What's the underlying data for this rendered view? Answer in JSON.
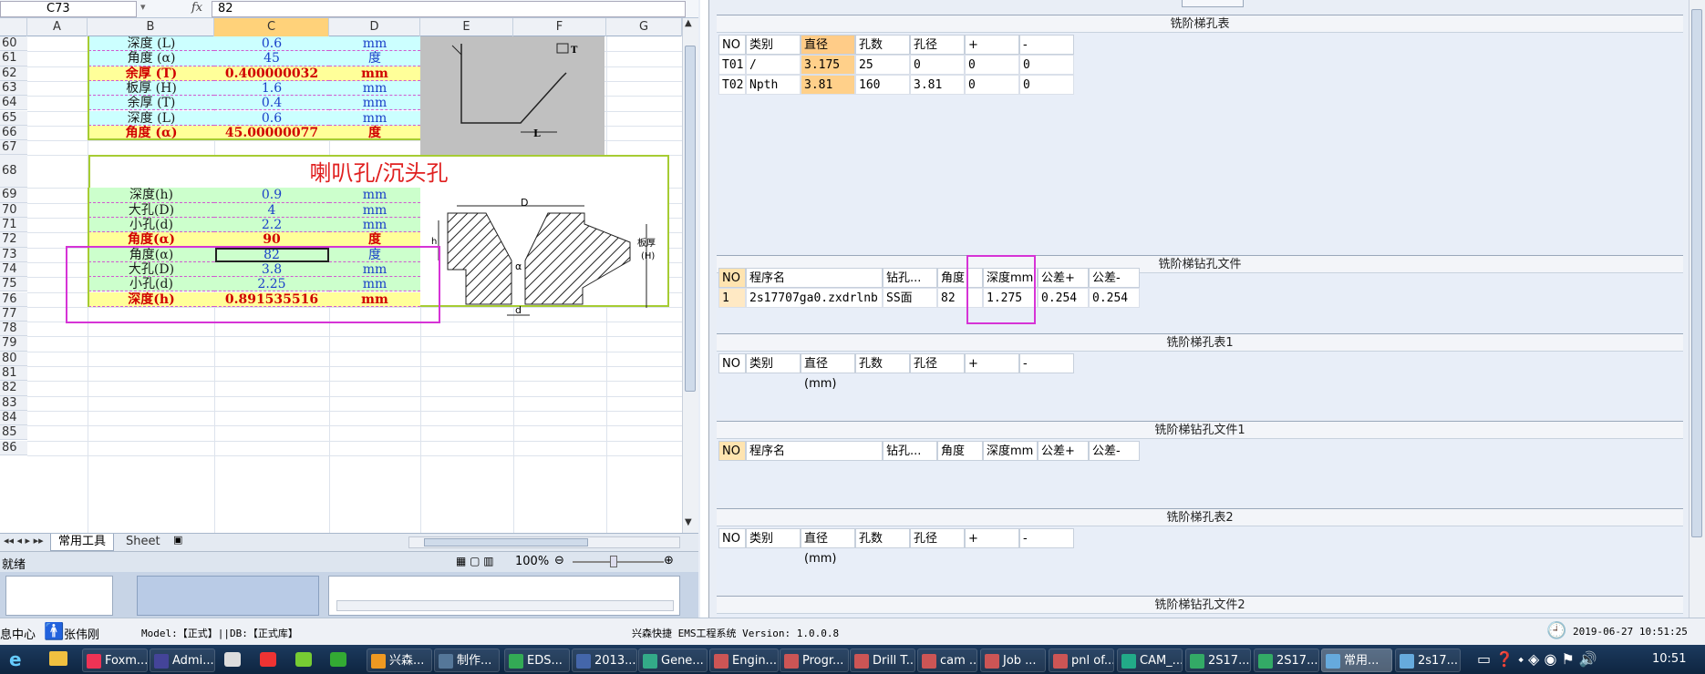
{
  "excel": {
    "namebox": "C73",
    "fx": "fx",
    "formula_value": "82",
    "columns": [
      "A",
      "B",
      "C",
      "D",
      "E",
      "F",
      "G"
    ],
    "rows": [
      "60",
      "61",
      "62",
      "63",
      "64",
      "65",
      "66",
      "67",
      "68",
      "69",
      "70",
      "71",
      "72",
      "73",
      "74",
      "75",
      "76",
      "77",
      "78",
      "79",
      "80",
      "81",
      "82",
      "83",
      "84",
      "85",
      "86"
    ],
    "block1": [
      {
        "label": "深度 (L)",
        "value": "0.6",
        "unit": "mm",
        "style": "cyan"
      },
      {
        "label": "角度 (α)",
        "value": "45",
        "unit": "度",
        "style": "cyan"
      },
      {
        "label": "余厚 (T)",
        "value": "0.400000032",
        "unit": "mm",
        "style": "yel"
      },
      {
        "label": "板厚 (H)",
        "value": "1.6",
        "unit": "mm",
        "style": "cyan"
      },
      {
        "label": "余厚 (T)",
        "value": "0.4",
        "unit": "mm",
        "style": "cyan"
      },
      {
        "label": "深度 (L)",
        "value": "0.6",
        "unit": "mm",
        "style": "cyan"
      },
      {
        "label": "角度 (α)",
        "value": "45.00000077",
        "unit": "度",
        "style": "yel"
      }
    ],
    "block2_title": "喇叭孔/沉头孔",
    "block2": [
      {
        "label": "深度(h)",
        "value": "0.9",
        "unit": "mm",
        "style": "grn"
      },
      {
        "label": "大孔(D)",
        "value": "4",
        "unit": "mm",
        "style": "grn"
      },
      {
        "label": "小孔(d)",
        "value": "2.2",
        "unit": "mm",
        "style": "grn"
      },
      {
        "label": "角度(α)",
        "value": "90",
        "unit": "度",
        "style": "yel"
      },
      {
        "label": "角度(α)",
        "value": "82",
        "unit": "度",
        "style": "grn"
      },
      {
        "label": "大孔(D)",
        "value": "3.8",
        "unit": "mm",
        "style": "grn"
      },
      {
        "label": "小孔(d)",
        "value": "2.25",
        "unit": "mm",
        "style": "grn"
      },
      {
        "label": "深度(h)",
        "value": "0.891535516",
        "unit": "mm",
        "style": "yel"
      }
    ],
    "diagram1_labels": {
      "T": "T",
      "L": "L"
    },
    "diagram2_labels": {
      "D": "D",
      "d": "d",
      "alpha": "α",
      "h": "h",
      "H": "板厚\n(H)"
    },
    "sheet_tab_active": "常用工具",
    "sheet_tab_2": "Sheet",
    "status_ready": "就绪",
    "zoom": "100%"
  },
  "right": {
    "sections": [
      {
        "title": "铣阶梯孔表"
      },
      {
        "title": "铣阶梯钻孔文件"
      },
      {
        "title": "铣阶梯孔表1"
      },
      {
        "title": "铣阶梯钻孔文件1"
      },
      {
        "title": "铣阶梯孔表2"
      },
      {
        "title": "铣阶梯钻孔文件2"
      }
    ],
    "hole_headers": [
      "NO",
      "类别",
      "直径(mm)",
      "孔数",
      "孔径",
      "+",
      "-"
    ],
    "hole_rows": [
      [
        "T01",
        "/",
        "3.175",
        "25",
        "0",
        "0",
        "0"
      ],
      [
        "T02",
        "Npth",
        "3.81",
        "160",
        "3.81",
        "0",
        "0"
      ]
    ],
    "drill_headers": [
      "NO",
      "程序名",
      "钻孔...",
      "角度",
      "深度mm",
      "公差+",
      "公差-"
    ],
    "drill_rows": [
      [
        "1",
        "2s17707ga0.zxdrlnb",
        "SS面",
        "82",
        "1.275",
        "0.254",
        "0.254"
      ]
    ]
  },
  "status": {
    "left_text": "息中心",
    "user": "张伟刚",
    "model": "Model:【正式】||DB:【正式库】",
    "system": "兴森快捷 EMS工程系统 Version: 1.0.0.8",
    "datetime": "2019-06-27 10:51:25"
  },
  "taskbar": {
    "buttons": [
      "Foxm...",
      "Admi...",
      "兴森...",
      "制作...",
      "EDS...",
      "2013...",
      "Gene...",
      "Engin...",
      "Progr...",
      "Drill T...",
      "cam ...",
      "Job ...",
      "pnl of...",
      "CAM_...",
      "2S17...",
      "2S17...",
      "常用...",
      "2s17..."
    ],
    "clock": "10:51"
  },
  "colors": {
    "highlight": "#d633d6",
    "selected_col": "#ffcc88"
  }
}
